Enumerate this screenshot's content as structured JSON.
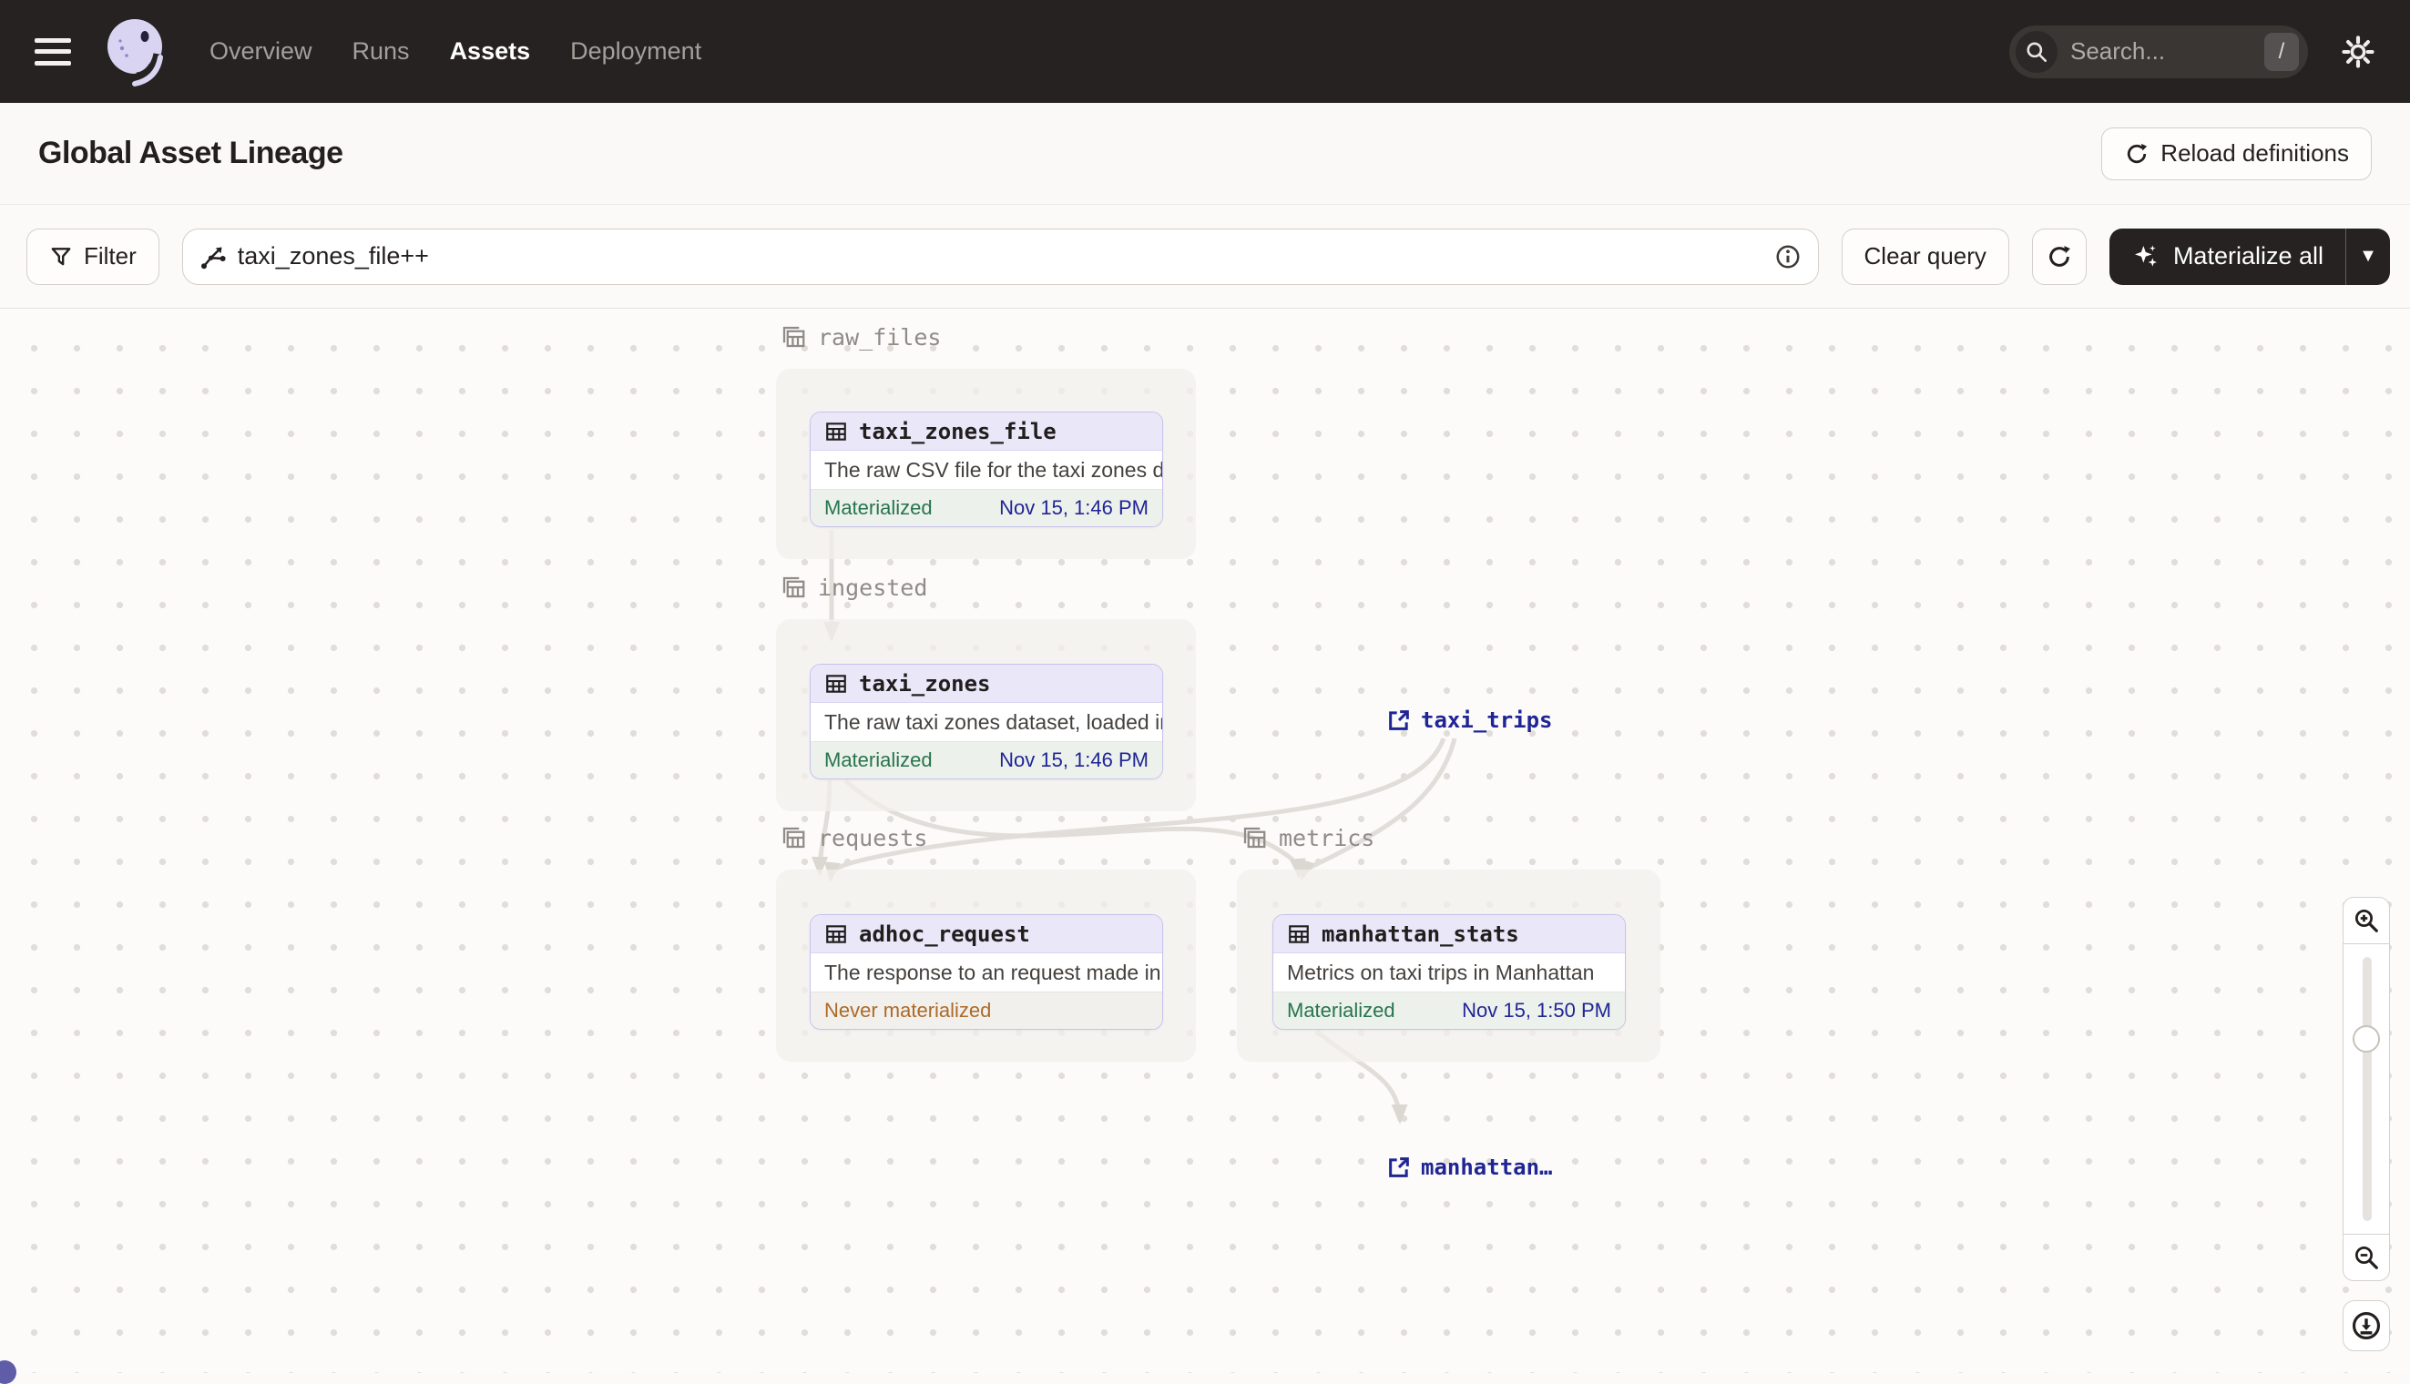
{
  "navbar": {
    "links": [
      {
        "label": "Overview",
        "active": false
      },
      {
        "label": "Runs",
        "active": false
      },
      {
        "label": "Assets",
        "active": true
      },
      {
        "label": "Deployment",
        "active": false
      }
    ],
    "search_placeholder": "Search...",
    "search_shortcut": "/"
  },
  "header": {
    "title": "Global Asset Lineage",
    "reload_button_label": "Reload definitions"
  },
  "toolbar": {
    "filter_label": "Filter",
    "query_value": "taxi_zones_file++",
    "clear_query_label": "Clear query",
    "materialize_label": "Materialize all"
  },
  "graph": {
    "groups": [
      {
        "name": "raw_files"
      },
      {
        "name": "ingested"
      },
      {
        "name": "requests"
      },
      {
        "name": "metrics"
      }
    ],
    "nodes": [
      {
        "name": "taxi_zones_file",
        "description": "The raw CSV file for the taxi zones dat...",
        "status": "Materialized",
        "timestamp": "Nov 15, 1:46 PM"
      },
      {
        "name": "taxi_zones",
        "description": "The raw taxi zones dataset, loaded int...",
        "status": "Materialized",
        "timestamp": "Nov 15, 1:46 PM"
      },
      {
        "name": "adhoc_request",
        "description": "The response to an request made in th...",
        "status": "Never materialized",
        "timestamp": ""
      },
      {
        "name": "manhattan_stats",
        "description": "Metrics on taxi trips in Manhattan",
        "status": "Materialized",
        "timestamp": "Nov 15, 1:50 PM"
      }
    ],
    "external_assets": [
      {
        "label": "taxi_trips"
      },
      {
        "label": "manhattan…"
      }
    ]
  },
  "colors": {
    "navbar_bg": "#262221",
    "node_border_purple": "#C7C2EC",
    "node_header_bg": "#EAE7F9",
    "materialized_green": "#27754C",
    "timestamp_navy": "#202594",
    "never_materialized_orange": "#AD6A27",
    "edge_gray": "#E1DED9"
  }
}
